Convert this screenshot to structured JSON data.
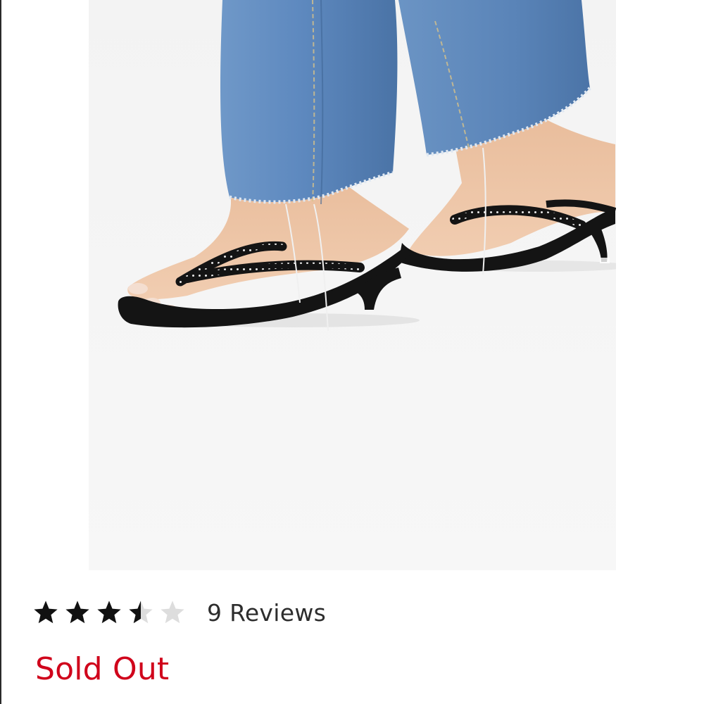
{
  "product": {
    "image_alt": "Black studded kitten heel thong sandals worn with raw hem blue jeans",
    "rating": 3.5,
    "rating_max": 5,
    "reviews_label": "9 Reviews",
    "stock_status": "Sold Out"
  },
  "colors": {
    "star_filled": "#111111",
    "star_empty": "#dddddd",
    "sold_out": "#d0021b",
    "denim": "#5d88bf",
    "skin": "#eec6a8",
    "sandal": "#141414"
  }
}
